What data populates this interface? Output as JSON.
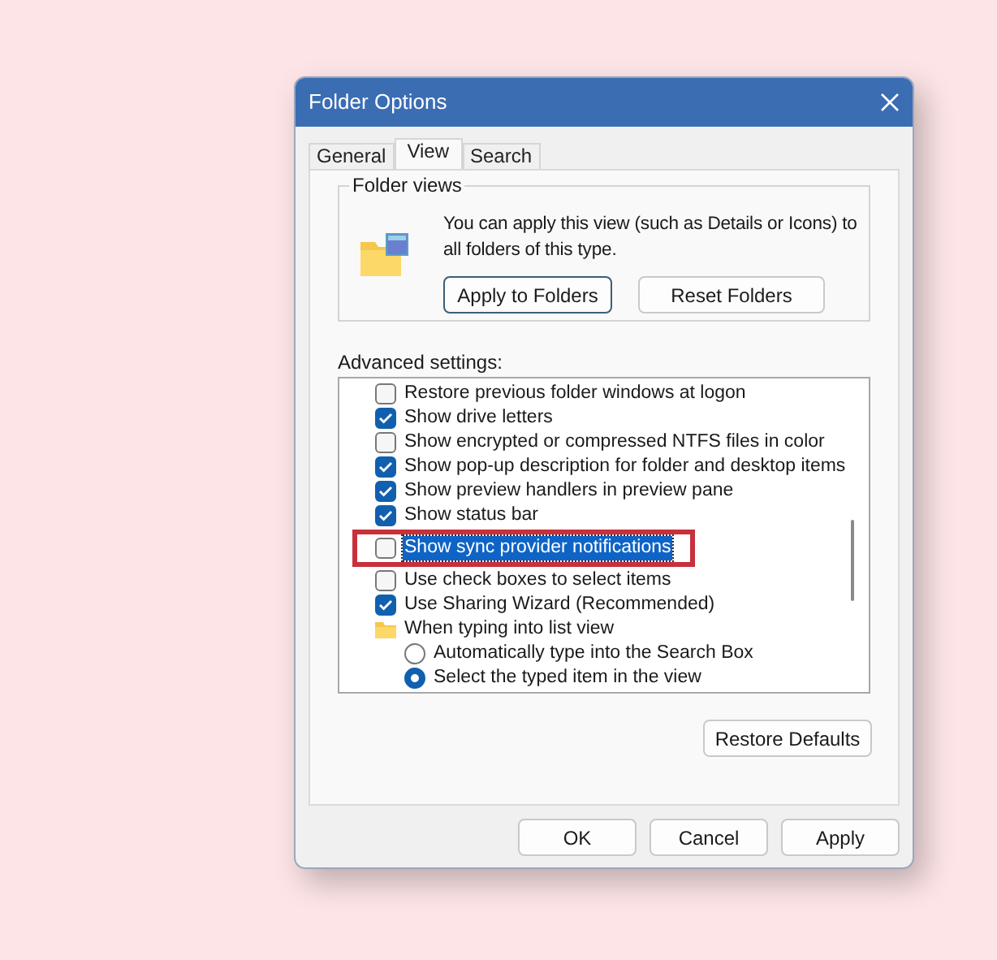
{
  "window": {
    "title": "Folder Options"
  },
  "tabs": [
    {
      "label": "General",
      "selected": false
    },
    {
      "label": "View",
      "selected": true
    },
    {
      "label": "Search",
      "selected": false
    }
  ],
  "folder_views": {
    "legend": "Folder views",
    "description": "You can apply this view (such as Details or Icons) to all folders of this type.",
    "buttons": [
      {
        "label": "Apply to Folders",
        "focused": true
      },
      {
        "label": "Reset Folders",
        "focused": false
      }
    ]
  },
  "advanced": {
    "label": "Advanced settings:",
    "items": [
      {
        "kind": "checkbox",
        "label": "Restore previous folder windows at logon",
        "checked": false,
        "selected": false
      },
      {
        "kind": "checkbox",
        "label": "Show drive letters",
        "checked": true,
        "selected": false
      },
      {
        "kind": "checkbox",
        "label": "Show encrypted or compressed NTFS files in color",
        "checked": false,
        "selected": false
      },
      {
        "kind": "checkbox",
        "label": "Show pop-up description for folder and desktop items",
        "checked": true,
        "selected": false
      },
      {
        "kind": "checkbox",
        "label": "Show preview handlers in preview pane",
        "checked": true,
        "selected": false
      },
      {
        "kind": "checkbox",
        "label": "Show status bar",
        "checked": true,
        "selected": false
      },
      {
        "kind": "checkbox",
        "label": "Show sync provider notifications",
        "checked": false,
        "selected": true,
        "highlighted": true
      },
      {
        "kind": "checkbox",
        "label": "Use check boxes to select items",
        "checked": false,
        "selected": false
      },
      {
        "kind": "checkbox",
        "label": "Use Sharing Wizard (Recommended)",
        "checked": true,
        "selected": false
      },
      {
        "kind": "folder",
        "label": "When typing into list view",
        "selected": false,
        "children": [
          {
            "kind": "radio",
            "label": "Automatically type into the Search Box",
            "checked": false,
            "selected": false
          },
          {
            "kind": "radio",
            "label": "Select the typed item in the view",
            "checked": true,
            "selected": false
          }
        ]
      }
    ]
  },
  "restore_button": "Restore Defaults",
  "footer_buttons": [
    "OK",
    "Cancel",
    "Apply"
  ]
}
